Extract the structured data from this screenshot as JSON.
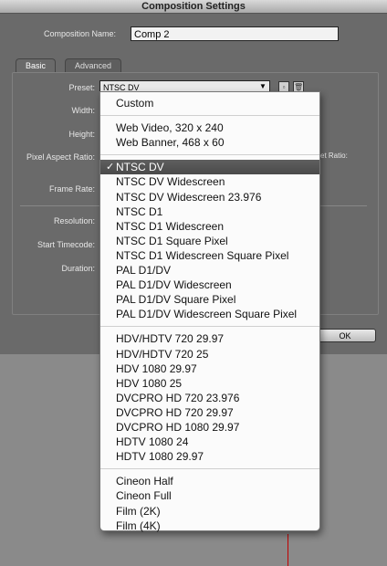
{
  "window": {
    "title": "Composition Settings"
  },
  "form": {
    "comp_name_label": "Composition Name:",
    "comp_name_value": "Comp 2",
    "tabs": [
      "Basic",
      "Advanced"
    ],
    "preset_label": "Preset:",
    "preset_value": "NTSC DV",
    "labels": {
      "width": "Width:",
      "height": "Height:",
      "pixel_aspect": "Pixel Aspect Ratio:",
      "frame_rate": "Frame Rate:",
      "resolution": "Resolution:",
      "start_timecode": "Start Timecode:",
      "duration": "Duration:",
      "partial_ratio": "et Ratio:"
    },
    "ok_label": "OK"
  },
  "dropdown": {
    "selected": "NTSC DV",
    "checkmark": "✓",
    "groups": [
      [
        "Custom"
      ],
      [
        "Web Video, 320 x 240",
        "Web Banner, 468 x 60"
      ],
      [
        "NTSC DV",
        "NTSC DV Widescreen",
        "NTSC DV Widescreen 23.976",
        "NTSC D1",
        "NTSC D1 Widescreen",
        "NTSC D1 Square Pixel",
        "NTSC D1 Widescreen Square Pixel",
        "PAL D1/DV",
        "PAL D1/DV Widescreen",
        "PAL D1/DV Square Pixel",
        "PAL D1/DV Widescreen Square Pixel"
      ],
      [
        "HDV/HDTV 720 29.97",
        "HDV/HDTV 720 25",
        "HDV 1080 29.97",
        "HDV 1080 25",
        "DVCPRO HD 720 23.976",
        "DVCPRO HD 720 29.97",
        "DVCPRO HD 1080 29.97",
        "HDTV 1080 24",
        "HDTV 1080 29.97"
      ],
      [
        "Cineon Half",
        "Cineon Full",
        "Film (2K)",
        "Film (4K)"
      ]
    ]
  },
  "icons": {
    "preset_arrow": "▼",
    "save_preset": "▫",
    "delete_preset": "🗑"
  }
}
